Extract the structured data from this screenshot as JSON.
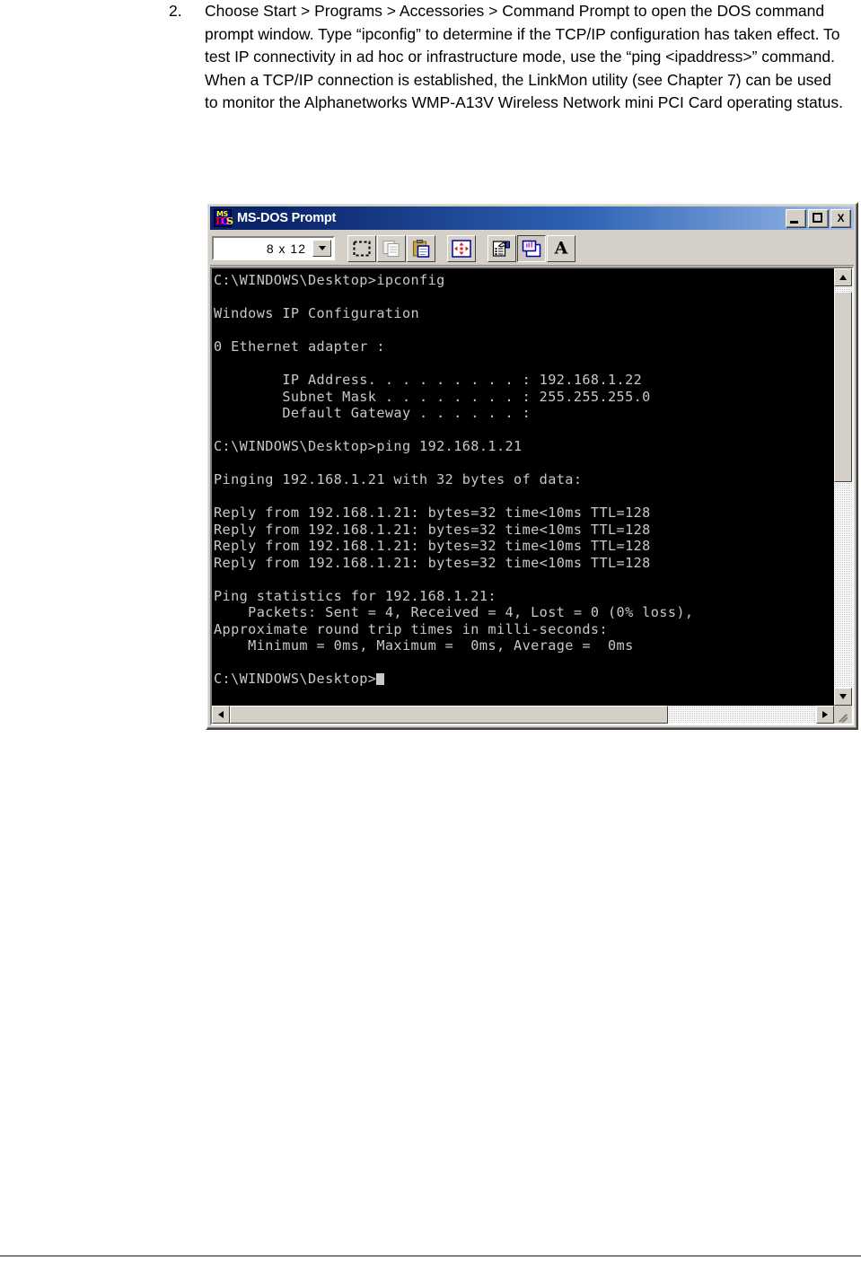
{
  "document": {
    "step": {
      "number": "2.",
      "text": "Choose Start > Programs > Accessories > Command Prompt to open the DOS command prompt window. Type “ipconfig” to determine if the TCP/IP configuration has taken effect. To test IP connectivity in ad hoc or infrastructure mode, use the “ping <ipaddress>” command. When a TCP/IP connection is established, the LinkMon utility (see Chapter 7) can be used to monitor the Alphanetworks WMP-A13V Wireless Network mini PCI Card operating status."
    }
  },
  "window": {
    "title": "MS-DOS Prompt",
    "icon_text": {
      "ms": "MS",
      "d": "D",
      "o": "O",
      "s": "S"
    },
    "controls": {
      "minimize": "minimize-button",
      "maximize": "maximize-button",
      "close": "X"
    },
    "toolbar": {
      "font_size_value": "8 x 12",
      "buttons": [
        {
          "name": "mark-button",
          "label": "Mark"
        },
        {
          "name": "copy-button",
          "label": "Copy"
        },
        {
          "name": "paste-button",
          "label": "Paste"
        },
        {
          "name": "full-screen-button",
          "label": "Full Screen"
        },
        {
          "name": "properties-button",
          "label": "Properties"
        },
        {
          "name": "background-button",
          "label": "Background"
        },
        {
          "name": "font-button",
          "label": "Font"
        }
      ]
    },
    "console": {
      "text": "C:\\WINDOWS\\Desktop>ipconfig\n\nWindows IP Configuration\n\n0 Ethernet adapter :\n\n        IP Address. . . . . . . . . : 192.168.1.22\n        Subnet Mask . . . . . . . . : 255.255.255.0\n        Default Gateway . . . . . . :\n\nC:\\WINDOWS\\Desktop>ping 192.168.1.21\n\nPinging 192.168.1.21 with 32 bytes of data:\n\nReply from 192.168.1.21: bytes=32 time<10ms TTL=128\nReply from 192.168.1.21: bytes=32 time<10ms TTL=128\nReply from 192.168.1.21: bytes=32 time<10ms TTL=128\nReply from 192.168.1.21: bytes=32 time<10ms TTL=128\n\nPing statistics for 192.168.1.21:\n    Packets: Sent = 4, Received = 4, Lost = 0 (0% loss),\nApproximate round trip times in milli-seconds:\n    Minimum = 0ms, Maximum =  0ms, Average =  0ms\n\nC:\\WINDOWS\\Desktop>",
      "prompt_path": "C:\\WINDOWS\\Desktop>",
      "commands": [
        "ipconfig",
        "ping 192.168.1.21"
      ],
      "ip_address": "192.168.1.22",
      "subnet_mask": "255.255.255.0",
      "default_gateway": "",
      "ping_target": "192.168.1.21",
      "packets_sent": "4",
      "packets_received": "4",
      "packets_lost": "0",
      "loss_percent": "0%",
      "minimum_ms": "0ms",
      "maximum_ms": "0ms",
      "average_ms": "0ms",
      "ttl": "128",
      "bytes": "32"
    }
  },
  "colors": {
    "titlebar_start": "#0a246a",
    "titlebar_end": "#a6c0e8",
    "window_face": "#d4d0c8",
    "console_bg": "#000000",
    "console_fg": "#c8c8c8"
  }
}
